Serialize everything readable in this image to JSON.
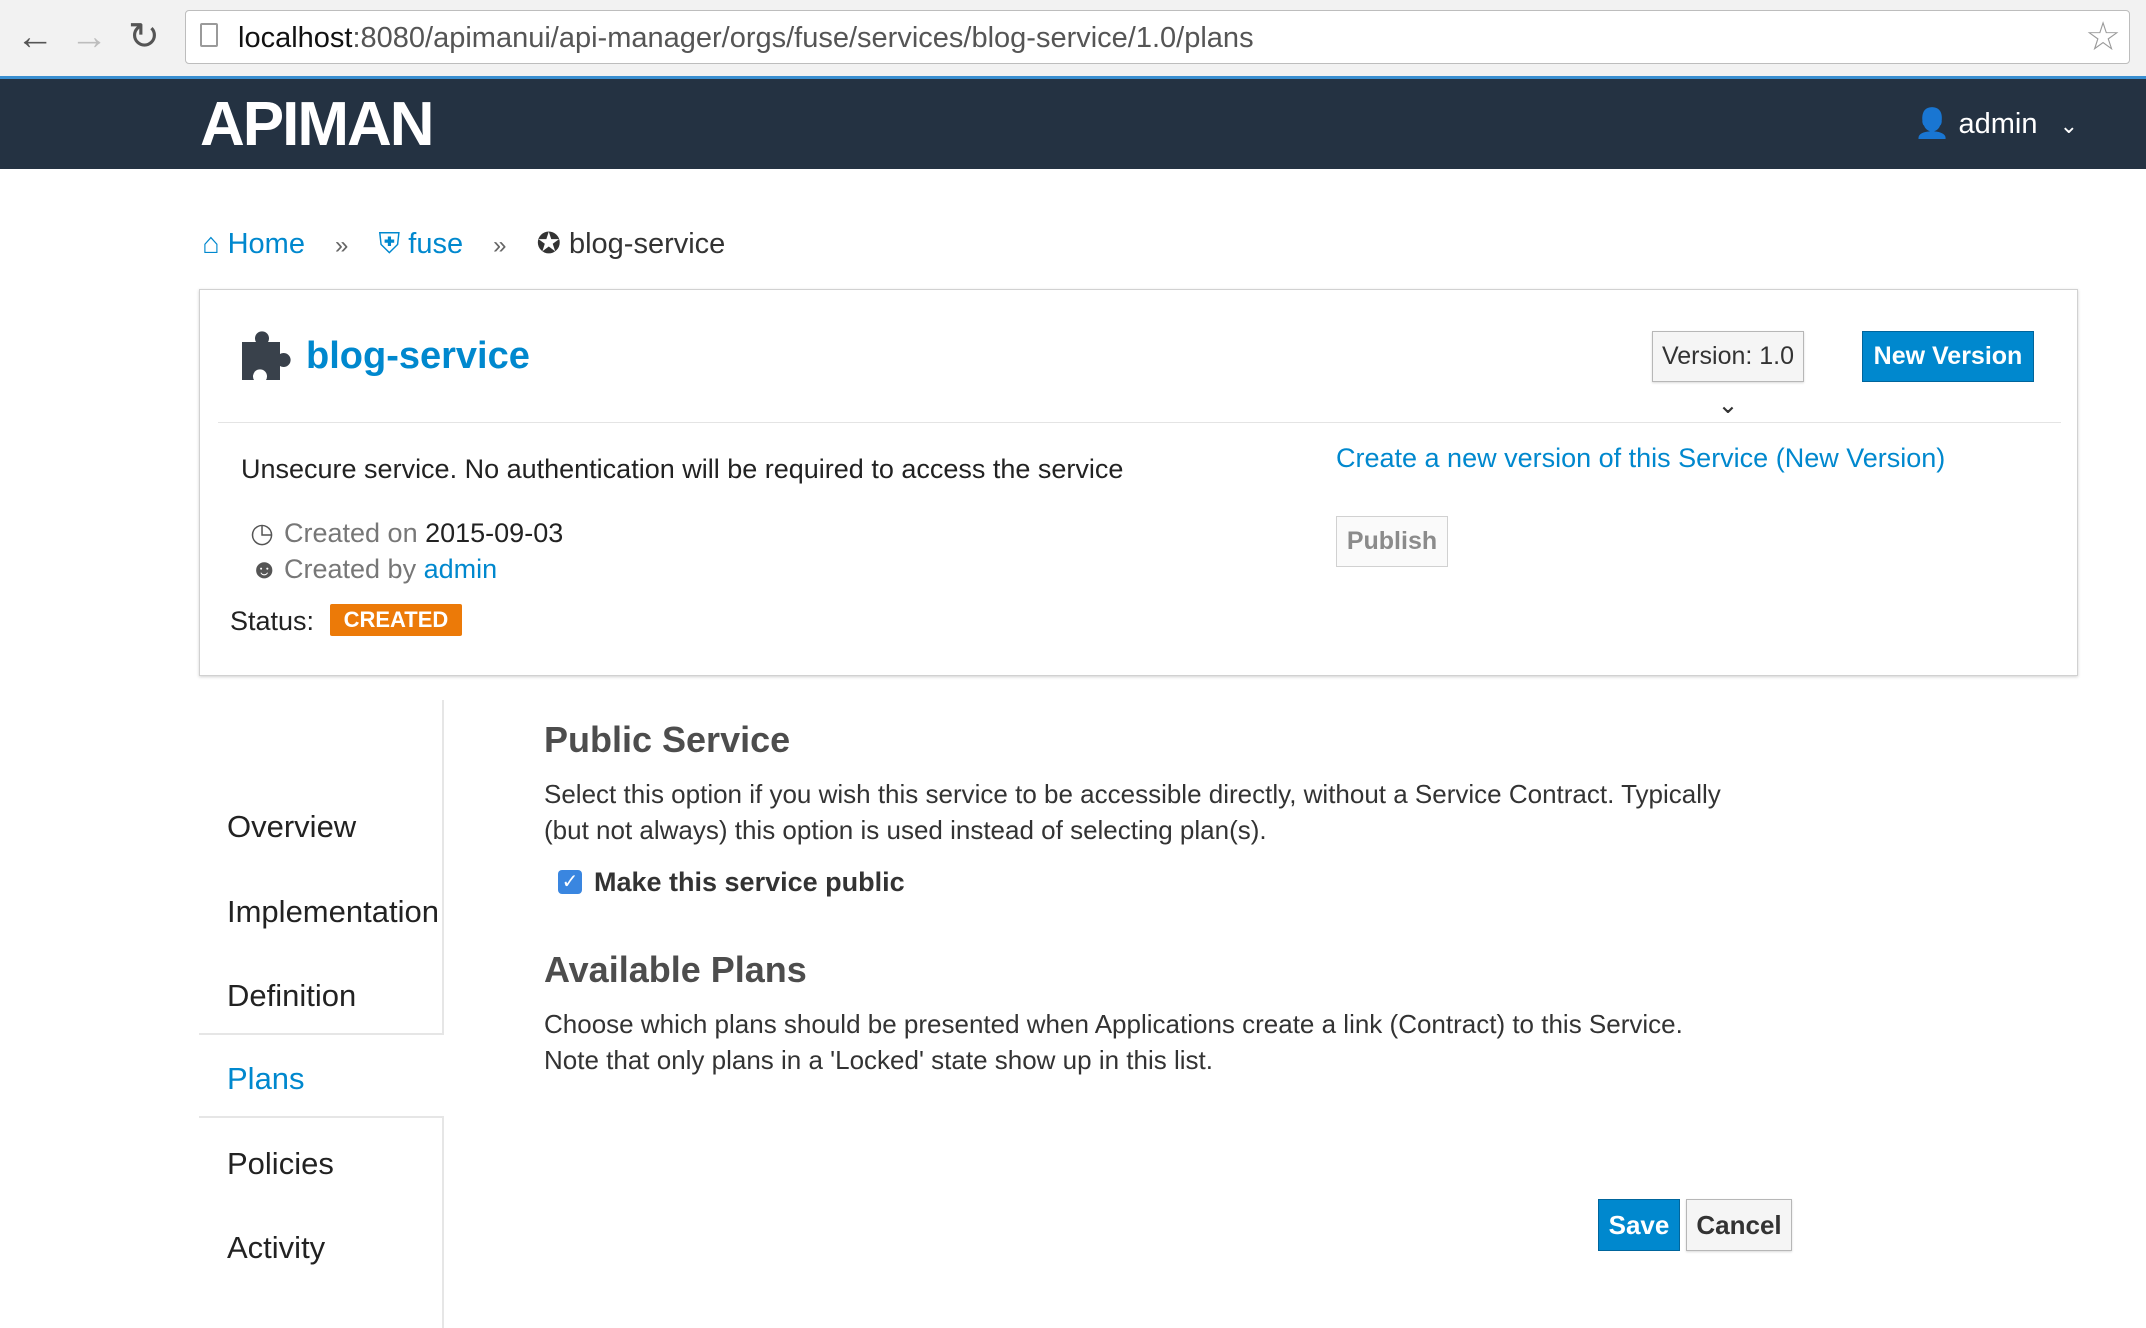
{
  "browser": {
    "url_host": "localhost",
    "url_path": ":8080/apimanui/api-manager/orgs/fuse/services/blog-service/1.0/plans"
  },
  "header": {
    "logo_text": "APIMAN",
    "user_label": "admin"
  },
  "breadcrumb": {
    "home": "Home",
    "org": "fuse",
    "service": "blog-service",
    "separator": "»"
  },
  "service": {
    "name": "blog-service",
    "version_label": "Version: 1.0",
    "new_version_label": "New Version",
    "description": "Unsecure service. No authentication will be required to access the service",
    "created_on_label": "Created on",
    "created_on_value": "2015-09-03",
    "created_by_label": "Created by",
    "created_by_value": "admin",
    "status_label": "Status:",
    "status_value": "CREATED",
    "status_color": "#ec7a08",
    "create_link": "Create a new version of this Service (New Version)",
    "publish_label": "Publish"
  },
  "nav": {
    "items": [
      {
        "label": "Overview"
      },
      {
        "label": "Implementation"
      },
      {
        "label": "Definition"
      },
      {
        "label": "Plans",
        "active": true
      },
      {
        "label": "Policies"
      },
      {
        "label": "Activity"
      }
    ]
  },
  "main": {
    "public_heading": "Public Service",
    "public_desc_line1": "Select this option if you wish this service to be accessible directly, without a Service Contract. Typically",
    "public_desc_line2": "(but not always) this option is used instead of selecting plan(s).",
    "public_checkbox_label": "Make this service public",
    "public_checked": true,
    "plans_heading": "Available Plans",
    "plans_desc_line1": "Choose which plans should be presented when Applications create a link (Contract) to this Service.",
    "plans_desc_line2": "Note that only plans in a 'Locked' state show up in this list."
  },
  "actions": {
    "save_label": "Save",
    "cancel_label": "Cancel"
  },
  "colors": {
    "accent": "#0088ce",
    "header_bg": "#243242"
  },
  "icons": {
    "back": "arrow-left-icon",
    "forward": "arrow-right-icon",
    "reload": "reload-icon",
    "page": "page-icon",
    "star": "star-icon",
    "user": "user-icon",
    "home": "home-icon",
    "org": "shield-icon",
    "service": "puzzle-icon",
    "clock": "clock-icon"
  }
}
